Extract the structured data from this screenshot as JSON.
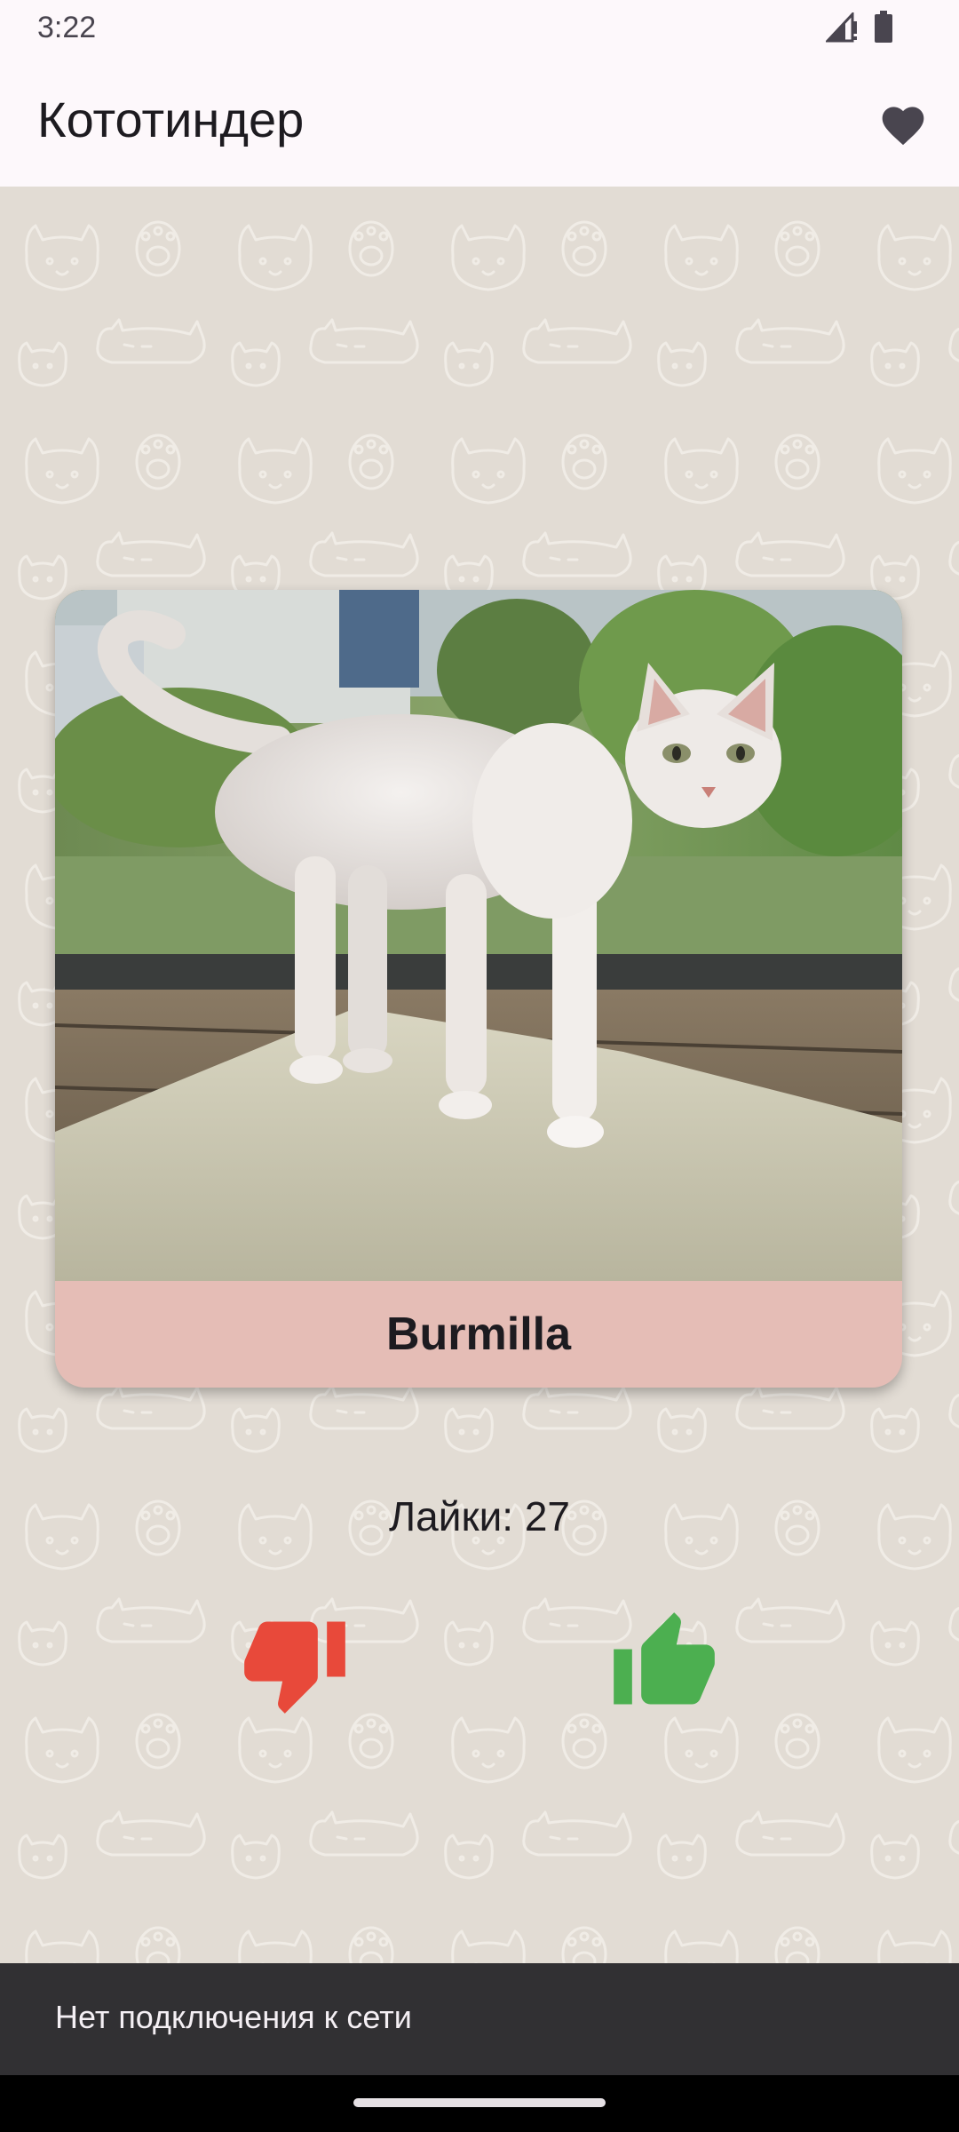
{
  "status_bar": {
    "time": "3:22"
  },
  "app_bar": {
    "title": "Кототиндер",
    "favorites_icon": "heart-icon"
  },
  "card": {
    "breed": "Burmilla"
  },
  "likes": {
    "text": "Лайки: 27"
  },
  "actions": {
    "dislike_icon": "thumb-down-icon",
    "like_icon": "thumb-up-icon"
  },
  "snackbar": {
    "message": "Нет подключения к сети"
  },
  "colors": {
    "background": "#e2dcd4",
    "card_label": "#e5bdb6",
    "dislike": "#e8493a",
    "like": "#4caf50",
    "snackbar": "#313033"
  }
}
